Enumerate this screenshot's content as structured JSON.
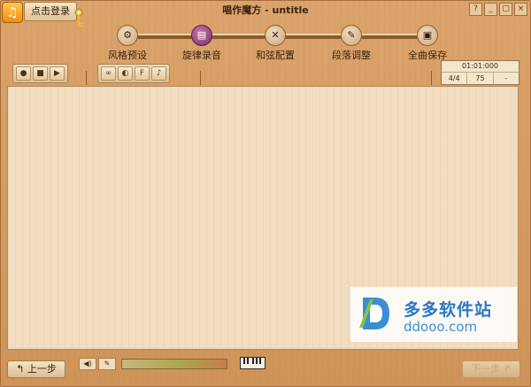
{
  "window": {
    "title": "唱作魔方 - untitle",
    "buttons": [
      "?",
      "_",
      "□",
      "×"
    ]
  },
  "login": {
    "label": "点击登录"
  },
  "steps": [
    {
      "label": "风格预设",
      "active": false
    },
    {
      "label": "旋律录音",
      "active": true
    },
    {
      "label": "和弦配置",
      "active": false
    },
    {
      "label": "段落调整",
      "active": false
    },
    {
      "label": "全曲保存",
      "active": false
    }
  ],
  "transport": {
    "time": "01:01:000",
    "signature": "4/4",
    "tempo": "75",
    "key": "-"
  },
  "watermark": {
    "text": "多多软件站",
    "url": "ddooo.com"
  },
  "bottom": {
    "prev": "上一步",
    "next": "下一步"
  },
  "colors": {
    "active_step": "#7a2c6c",
    "wood": "#d79e63"
  }
}
